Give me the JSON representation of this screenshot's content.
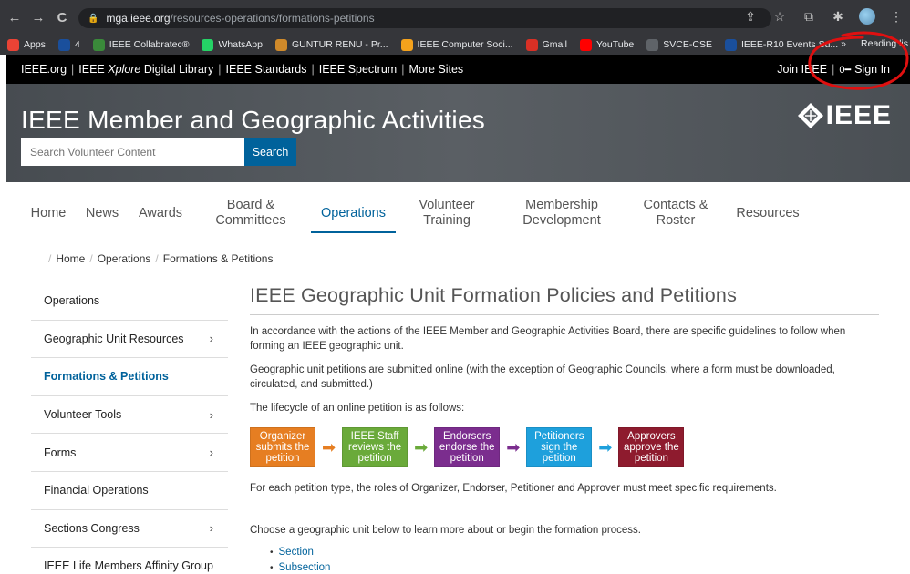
{
  "browser": {
    "url_domain": "mga.ieee.org",
    "url_path": "/resources-operations/formations-petitions",
    "nav": {
      "back": "←",
      "forward": "→",
      "reload": "C"
    },
    "bookmarks": [
      {
        "label": "Apps",
        "icon": "apps-grid-icon",
        "color": "#ea4335"
      },
      {
        "label": "4",
        "icon": "ieee-bookmark-icon",
        "color": "#1a4f9c"
      },
      {
        "label": "IEEE Collabratec®",
        "icon": "collabratec-icon",
        "color": "#3a8a3a"
      },
      {
        "label": "WhatsApp",
        "icon": "whatsapp-icon",
        "color": "#25d366"
      },
      {
        "label": "GUNTUR RENU - Pr...",
        "icon": "guntur-icon",
        "color": "#d08a2a"
      },
      {
        "label": "IEEE Computer Soci...",
        "icon": "computer-society-icon",
        "color": "#f4a21c"
      },
      {
        "label": "Gmail",
        "icon": "gmail-icon",
        "color": "#d93025"
      },
      {
        "label": "YouTube",
        "icon": "youtube-icon",
        "color": "#ff0000"
      },
      {
        "label": "SVCE-CSE",
        "icon": "svce-icon",
        "color": "#5f6368"
      },
      {
        "label": "IEEE-R10 Events Su...",
        "icon": "ieee-r10-icon",
        "color": "#1a4f9c"
      }
    ],
    "more_bookmarks": "»",
    "reading_list": "Reading lis"
  },
  "topbar": {
    "links": [
      "IEEE.org",
      "IEEE Xplore Digital Library",
      "IEEE Standards",
      "IEEE Spectrum",
      "More Sites"
    ],
    "join": "Join IEEE",
    "sign_in": "Sign In"
  },
  "header": {
    "title": "IEEE Member and Geographic Activities",
    "search_placeholder": "Search Volunteer Content",
    "search_button": "Search",
    "logo_text": "IEEE"
  },
  "mainnav": {
    "items": [
      {
        "line1": "Home",
        "line2": ""
      },
      {
        "line1": "News",
        "line2": ""
      },
      {
        "line1": "Awards",
        "line2": ""
      },
      {
        "line1": "Board &",
        "line2": "Committees"
      },
      {
        "line1": "Operations",
        "line2": ""
      },
      {
        "line1": "Volunteer",
        "line2": "Training"
      },
      {
        "line1": "Membership",
        "line2": "Development"
      },
      {
        "line1": "Contacts &",
        "line2": "Roster"
      },
      {
        "line1": "Resources",
        "line2": ""
      }
    ],
    "active_index": 4
  },
  "breadcrumb": [
    "Home",
    "Operations",
    "Formations & Petitions"
  ],
  "sidebar": {
    "items": [
      {
        "label": "Operations",
        "chevron": ""
      },
      {
        "label": "Geographic Unit Resources",
        "chevron": "›"
      },
      {
        "label": "Formations & Petitions",
        "chevron": ""
      },
      {
        "label": "Volunteer Tools",
        "chevron": "›"
      },
      {
        "label": "Forms",
        "chevron": "›"
      },
      {
        "label": "Financial Operations",
        "chevron": ""
      },
      {
        "label": "Sections Congress",
        "chevron": "›"
      },
      {
        "label": "IEEE Life Members Affinity Group",
        "chevron": ""
      }
    ],
    "active_index": 2
  },
  "content": {
    "title": "IEEE Geographic Unit Formation Policies and Petitions",
    "para1": "In accordance with the actions of the IEEE Member and Geographic Activities Board, there are specific guidelines to follow when forming an IEEE geographic unit.",
    "para2": "Geographic unit petitions are submitted online (with the exception of Geographic Councils, where a form must be downloaded, circulated, and submitted.)",
    "para3": "The lifecycle of an online petition is as follows:",
    "steps": [
      {
        "text": "Organizer submits the petition",
        "color": "#e67e22",
        "arrow_color": "#e67e22"
      },
      {
        "text": "IEEE Staff reviews the petition",
        "color": "#6aaa3a",
        "arrow_color": "#6aaa3a"
      },
      {
        "text": "Endorsers endorse the petition",
        "color": "#7b2d8e",
        "arrow_color": "#7b2d8e"
      },
      {
        "text": "Petitioners sign the petition",
        "color": "#1ea0dc",
        "arrow_color": "#1ea0dc"
      },
      {
        "text": "Approvers approve the petition",
        "color": "#8e1b2e",
        "arrow_color": ""
      }
    ],
    "para4": "For each petition type, the roles of Organizer, Endorser, Petitioner and Approver must meet specific requirements.",
    "para5": "Choose a geographic unit below to learn more about or begin the formation process.",
    "units": [
      "Section",
      "Subsection"
    ]
  },
  "annotation_color": "#e01010"
}
